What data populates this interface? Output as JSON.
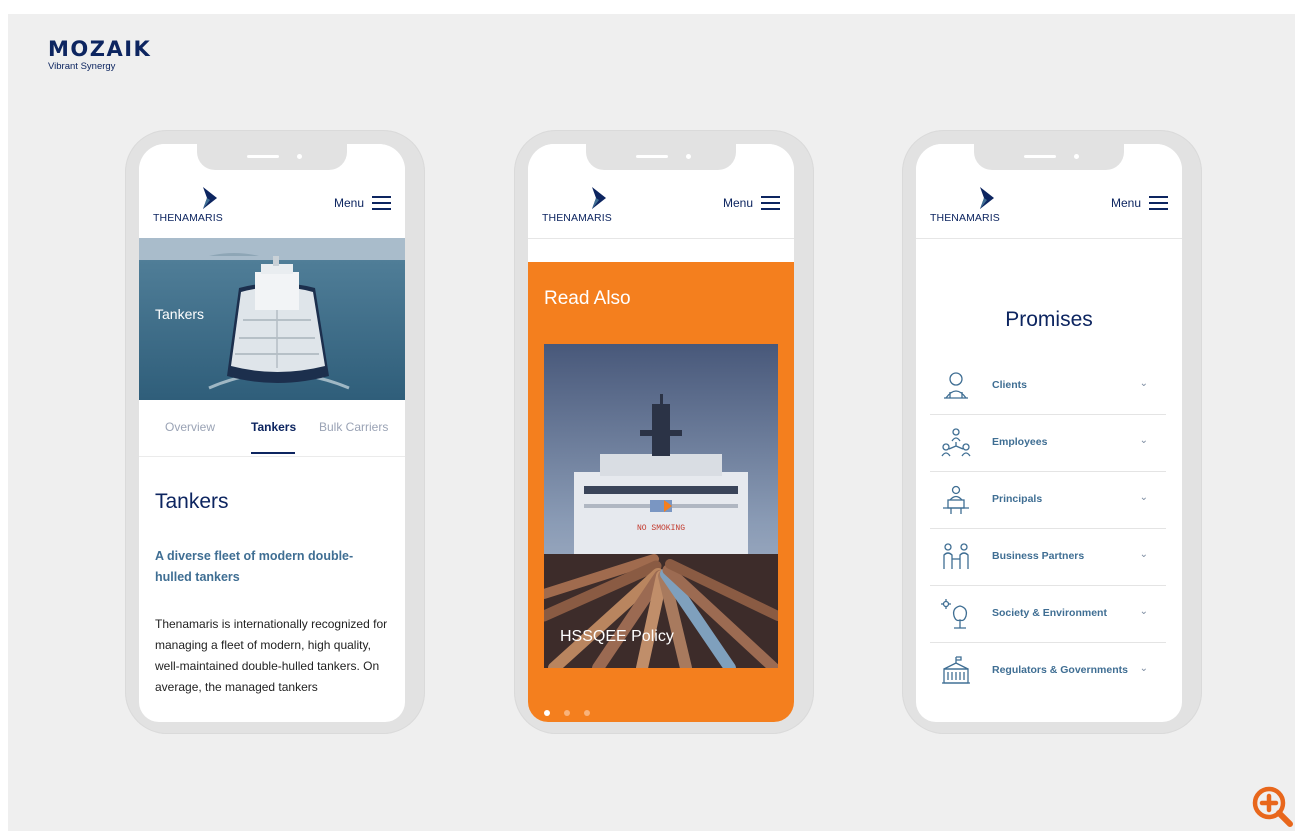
{
  "brand": {
    "name": "MOZAIK",
    "tagline": "Vibrant Synergy"
  },
  "header": {
    "logo_text": "THENAMARIS",
    "menu_label": "Menu"
  },
  "phone1": {
    "hero_label": "Tankers",
    "tabs": [
      {
        "label": "Overview"
      },
      {
        "label": "Tankers"
      },
      {
        "label": "Bulk Carriers"
      }
    ],
    "title": "Tankers",
    "subtitle": "A diverse fleet of modern double-hulled tankers",
    "body": "Thenamaris is internationally recognized for managing a fleet of modern, high quality, well-maintained double-hulled tankers. On average, the managed tankers"
  },
  "phone2": {
    "section_title": "Read Also",
    "card_label": "HSSQEE Policy",
    "ship_sign": "NO SMOKING"
  },
  "phone3": {
    "title": "Promises",
    "items": [
      {
        "label": "Clients",
        "icon": "person-icon"
      },
      {
        "label": "Employees",
        "icon": "team-icon"
      },
      {
        "label": "Principals",
        "icon": "desk-person-icon"
      },
      {
        "label": "Business Partners",
        "icon": "handshake-icon"
      },
      {
        "label": "Society & Environment",
        "icon": "tree-icon"
      },
      {
        "label": "Regulators & Governments",
        "icon": "government-building-icon"
      }
    ]
  },
  "colors": {
    "navy": "#0d2560",
    "orange": "#f47f1e",
    "steel_blue": "#3f6e93",
    "background": "#efefef"
  }
}
